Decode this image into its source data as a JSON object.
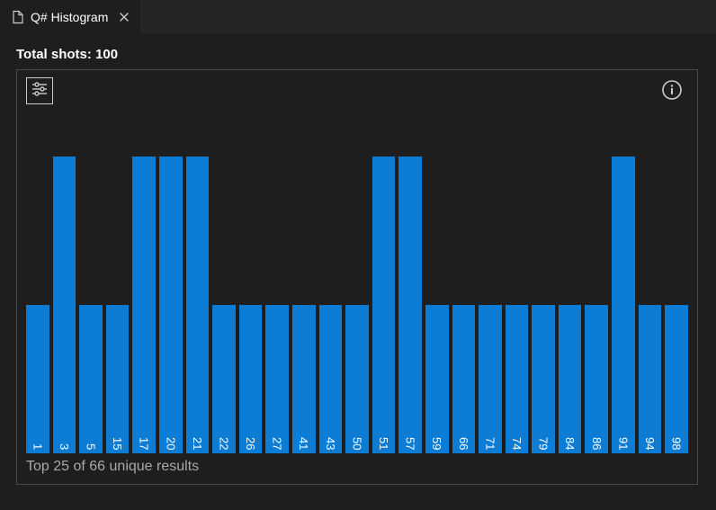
{
  "tab": {
    "label": "Q# Histogram"
  },
  "header": {
    "total_shots": "Total shots: 100"
  },
  "caption": "Top 25 of 66 unique results",
  "chart_data": {
    "type": "bar",
    "title": "Q# Histogram",
    "xlabel": "",
    "ylabel": "",
    "ylim": [
      0,
      4
    ],
    "categories": [
      "1",
      "3",
      "5",
      "15",
      "17",
      "20",
      "21",
      "22",
      "26",
      "27",
      "41",
      "43",
      "50",
      "51",
      "57",
      "59",
      "66",
      "71",
      "74",
      "79",
      "84",
      "86",
      "91",
      "94",
      "98"
    ],
    "values": [
      2,
      4,
      2,
      2,
      4,
      4,
      4,
      2,
      2,
      2,
      2,
      2,
      2,
      4,
      4,
      2,
      2,
      2,
      2,
      2,
      2,
      2,
      4,
      2,
      2
    ]
  }
}
